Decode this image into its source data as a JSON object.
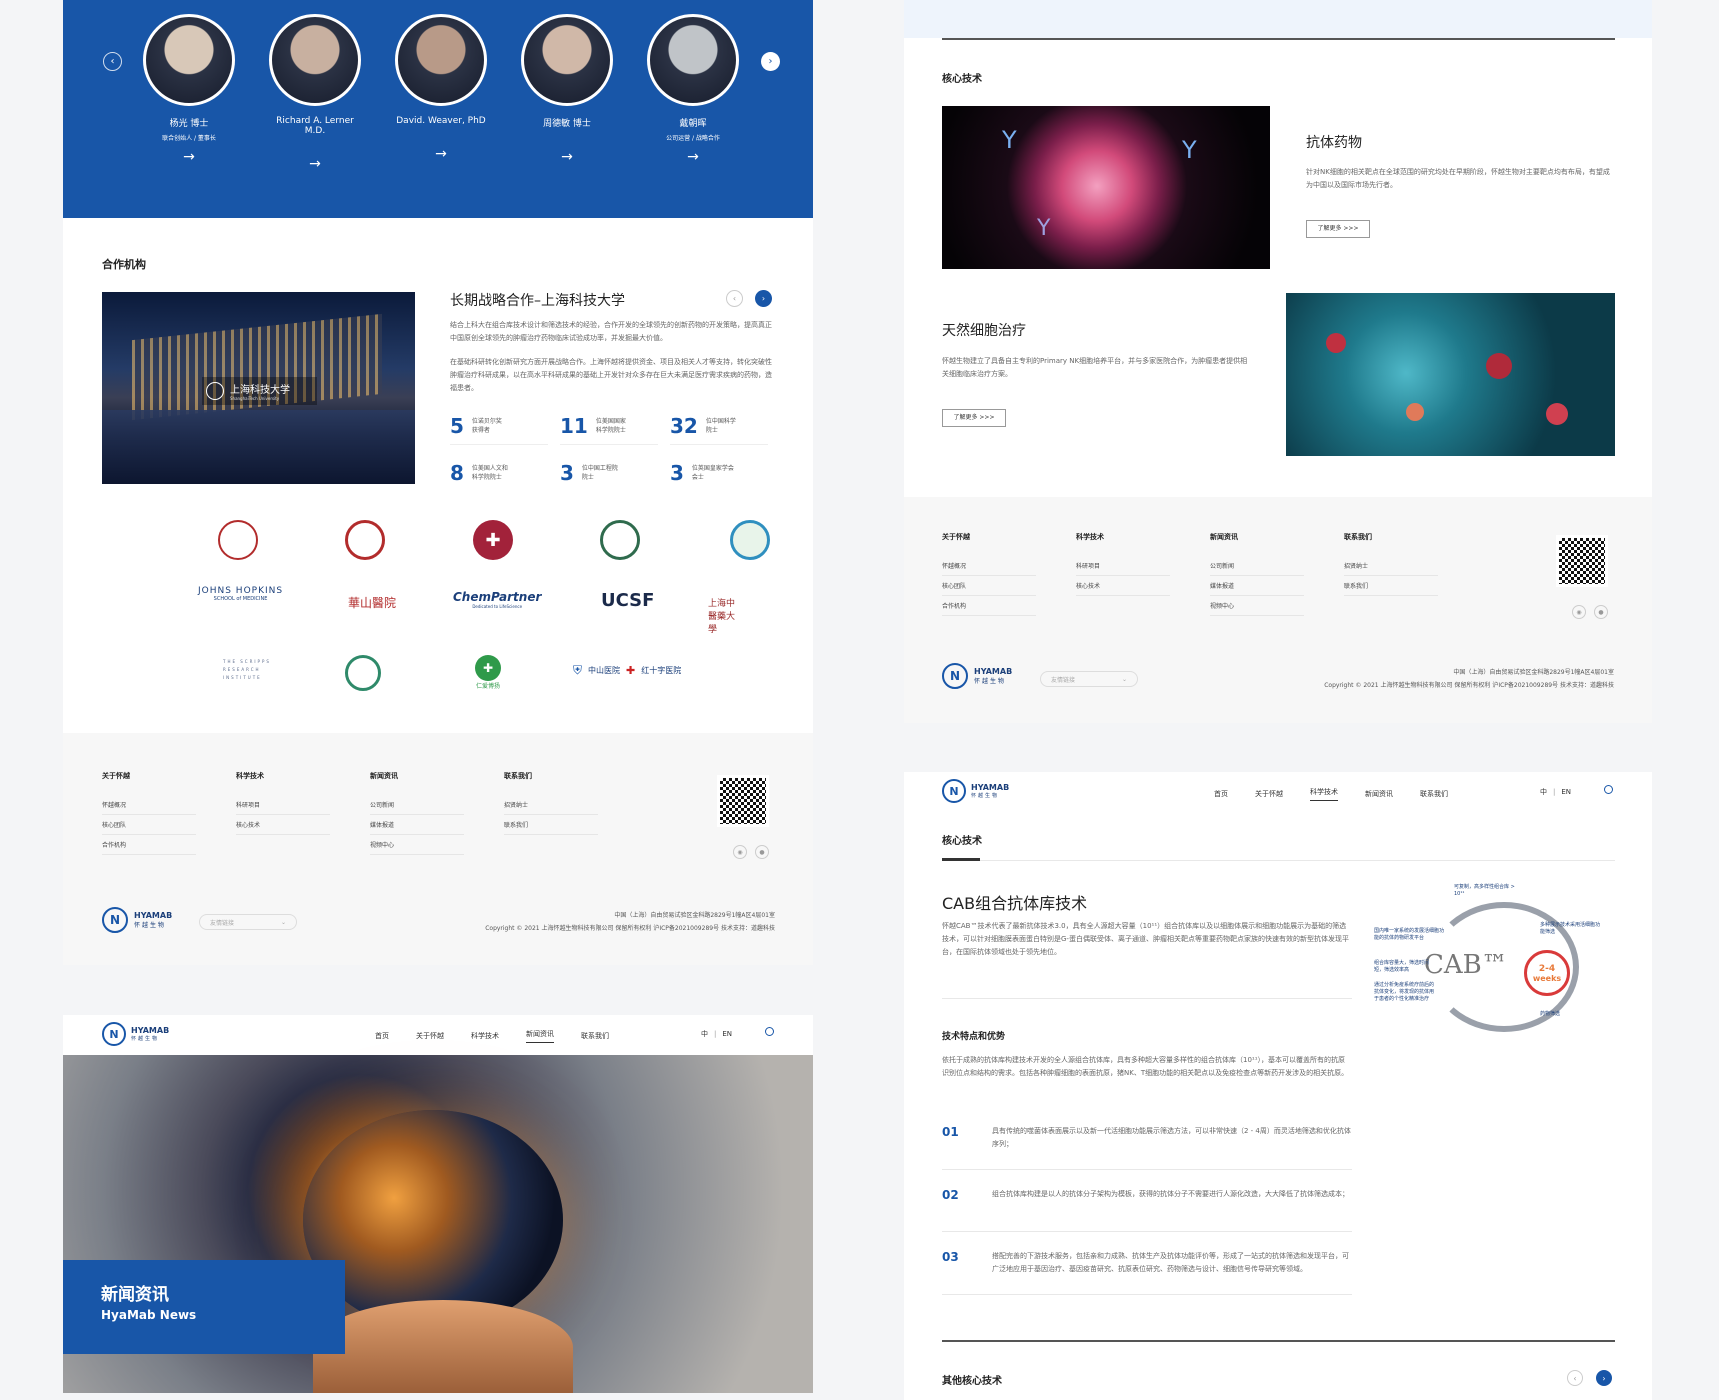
{
  "team": {
    "people": [
      {
        "name": "杨光 博士",
        "role": "联合创始人 / 董事长"
      },
      {
        "name": "Richard A. Lerner M.D.",
        "role": ""
      },
      {
        "name": "David. Weaver, PhD",
        "role": ""
      },
      {
        "name": "周德敏 博士",
        "role": ""
      },
      {
        "name": "戴朝晖",
        "role": "公司运营 / 战略合作"
      }
    ],
    "arrow": "→"
  },
  "partners": {
    "heading": "合作机构",
    "title": "长期战略合作–上海科技大学",
    "para1": "结合上科大在组合库技术设计和筛选技术的经验，合作开发的全球领先的创新药物的开发策略，提高真正中国原创全球领先的肿瘤治疗药物临床试验成功率，并发掘最大价值。",
    "para2": "在基础科研转化创新研究方面开展战略合作。上海怀越将提供资金、项目及相关人才等支持，转化突破性肿瘤治疗科研成果，以在高水平科研成果的基础上开发针对众多存在巨大未满足医疗需求疾病的药物，造福患者。",
    "photo_caption": "上海科技大学",
    "photo_caption_en": "ShanghaiTech University",
    "stats": [
      {
        "num": "5",
        "label1": "位诺贝尔奖",
        "label2": "获得者"
      },
      {
        "num": "11",
        "label1": "位美国国家",
        "label2": "科学院院士"
      },
      {
        "num": "32",
        "label1": "位中国科学",
        "label2": "院士"
      },
      {
        "num": "8",
        "label1": "位美国人文和",
        "label2": "科学院院士"
      },
      {
        "num": "3",
        "label1": "位中国工程院",
        "label2": "院士"
      },
      {
        "num": "3",
        "label1": "位英国皇家学会",
        "label2": "会士"
      }
    ],
    "logos_text": [
      "JOHNS HOPKINS",
      "SCHOOL of MEDICINE",
      "華山醫院",
      "ChemPartner",
      "Dedicated to LifeScience",
      "UCSF",
      "上海中醫藥大學",
      "THE SCRIPPS RESEARCH INSTITUTE",
      "仁爱博扬",
      "中山医院",
      "红十字医院"
    ]
  },
  "footer": {
    "cols": [
      {
        "title": "关于怀越",
        "items": [
          "怀越概况",
          "核心团队",
          "合作机构"
        ]
      },
      {
        "title": "科学技术",
        "items": [
          "科研项目",
          "核心技术"
        ]
      },
      {
        "title": "新闻资讯",
        "items": [
          "公司新闻",
          "媒体报道",
          "视频中心"
        ]
      },
      {
        "title": "联系我们",
        "items": [
          "招贤纳士",
          "联系我们"
        ]
      }
    ],
    "brand": "HYAMAB",
    "brand_cn": "怀越生物",
    "links_placeholder": "友情链接",
    "address": "中国（上海）自由贸易试验区金科路2829号1幢A区4层01室",
    "copyright": "Copyright © 2021 上海怀越生物科技有限公司  保留所有权利  沪ICP备2021009289号  技术支持：道趣科技"
  },
  "nav": {
    "items": [
      "首页",
      "关于怀越",
      "科学技术",
      "新闻资讯",
      "联系我们"
    ],
    "lang_cn": "中",
    "lang_sep": "|",
    "lang_en": "EN"
  },
  "news": {
    "title": "新闻资讯",
    "subtitle": "HyaMab News"
  },
  "core": {
    "heading": "核心技术",
    "item1": {
      "title": "抗体药物",
      "desc": "针对NK细胞的相关靶点在全球范围的研究均处在早期阶段，怀越生物对主要靶点均有布局，有望成为中国以及国际市场先行者。",
      "btn": "了解更多  >>>"
    },
    "item2": {
      "title": "天然细胞治疗",
      "desc": "怀越生物建立了具备自主专利的Primary NK细胞培养平台，并与多家医院合作，为肿瘤患者提供相关细胞临床治疗方案。",
      "btn": "了解更多  >>>"
    }
  },
  "cab": {
    "heading": "核心技术",
    "title": "CAB组合抗体库技术",
    "intro": "怀越CAB™技术代表了最新抗体技术3.0，具有全人源超大容量（10¹¹）组合抗体库以及以细胞体展示和细胞功能展示为基础的筛选技术，可以针对细胞膜表面蛋白特别是G-蛋白偶联受体、离子通道、肿瘤相关靶点等重要药物靶点家族的快速有效的新型抗体发现平台，在国际抗体领域也处于领先地位。",
    "feat_heading": "技术特点和优势",
    "feat_text": "依托于成熟的抗体库构建技术开发的全人源组合抗体库，具有多种超大容量多样性的组合抗体库（10¹¹），基本可以覆盖所有的抗原识别位点和结构的需求。包括各种肿瘤细胞的表面抗原，猪NK、T细胞功能的相关靶点以及免疫检查点等新药开发涉及的相关抗原。",
    "points": [
      {
        "num": "01",
        "text": "具有传统的噬菌体表面展示以及新一代活细胞功能展示筛选方法，可以非常快速（2 - 4周）而灵活地筛选和优化抗体序列；"
      },
      {
        "num": "02",
        "text": "组合抗体库构建是以人的抗体分子架构为模板，获得的抗体分子不需要进行人源化改造，大大降低了抗体筛选成本；"
      },
      {
        "num": "03",
        "text": "搭配完善的下游技术服务，包括亲和力成熟、抗体生产及抗体功能评价等，形成了一站式的抗体筛选和发现平台，可广泛地应用于基因治疗、基因疫苗研究、抗原表位研究、药物筛选与设计、细胞信号传导研究等领域。"
      }
    ],
    "other_heading": "其他核心技术",
    "diagram": {
      "logo": "CAB™",
      "weeks": "2-4",
      "weeks_label": "weeks",
      "label1": "可复制，高多样性组合库 > 10¹¹",
      "label2": "国内唯一家系统的发展活细胞功能的抗体药物研发平台",
      "label3": "组合库容量大，筛选时间短，筛选效率高",
      "label4": "通过分析免疫系统疗前后的抗体变化，将发现的抗体用于患者的个性化精准治疗",
      "label5": "多种展示技术采用活细胞功能筛选",
      "label6": "药物筛选"
    }
  }
}
